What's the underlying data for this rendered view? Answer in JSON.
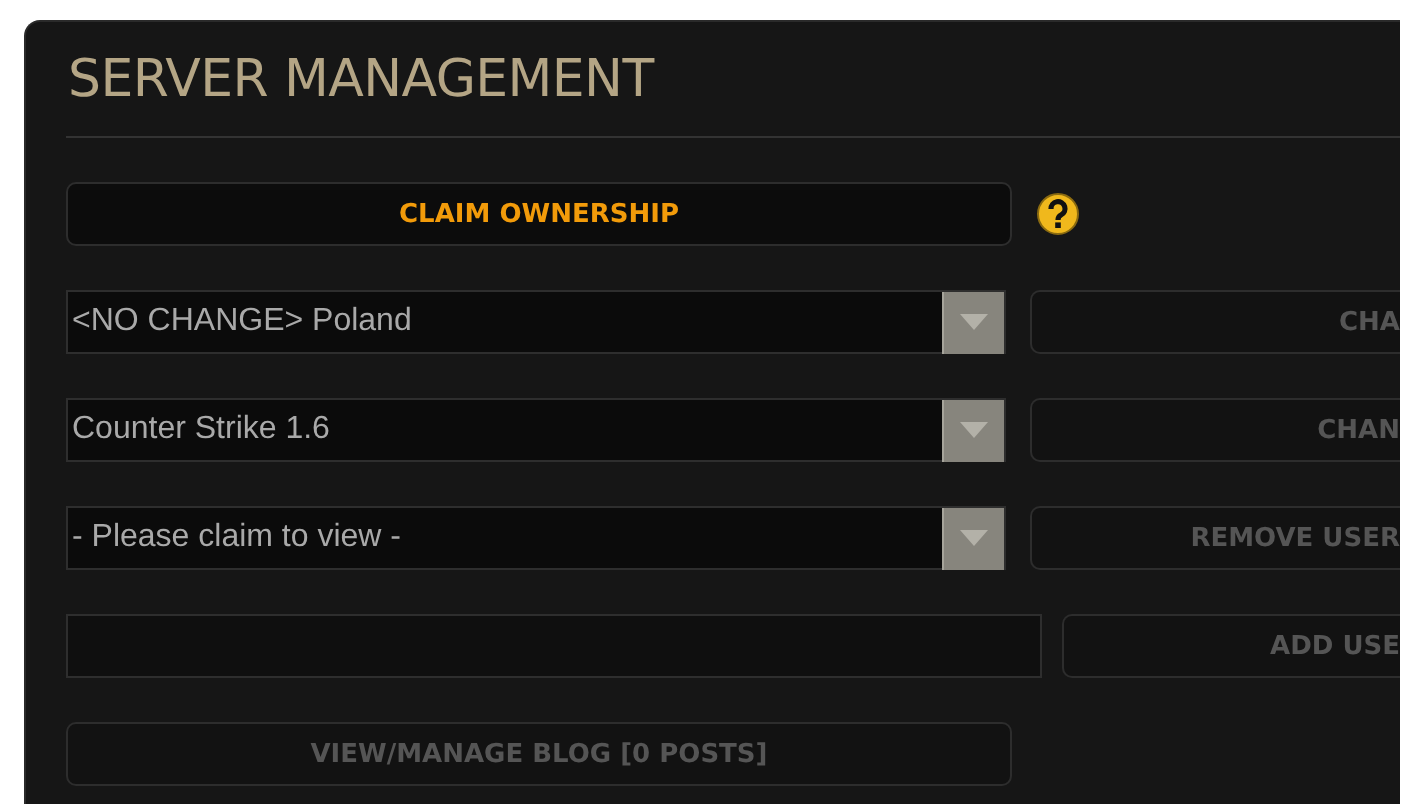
{
  "panel": {
    "title": "SERVER MANAGEMENT"
  },
  "claim_button": {
    "label": "CLAIM OWNERSHIP",
    "disabled": false
  },
  "rows": [
    {
      "kind": "select",
      "value": "<NO CHANGE> Poland",
      "button": {
        "label": "CHA",
        "disabled": true
      }
    },
    {
      "kind": "select",
      "value": "Counter Strike 1.6",
      "button": {
        "label": "CHAN",
        "disabled": true
      }
    },
    {
      "kind": "select",
      "value": "- Please claim to view -",
      "button": {
        "label": "REMOVE USER",
        "disabled": true
      }
    },
    {
      "kind": "input",
      "value": "",
      "button": {
        "label": "ADD USE",
        "disabled": true
      }
    }
  ],
  "blog_button": {
    "label": "VIEW/MANAGE BLOG [0 POSTS]",
    "disabled": true
  }
}
